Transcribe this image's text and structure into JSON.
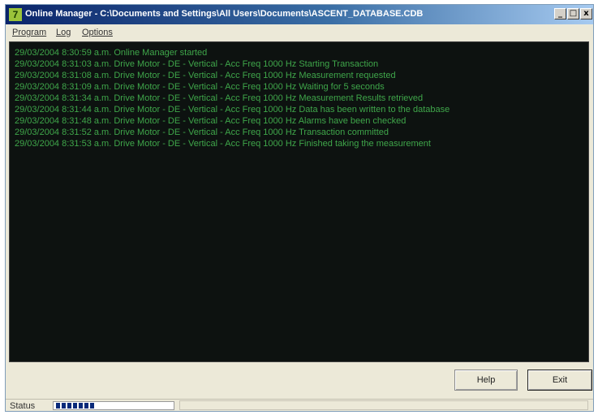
{
  "window": {
    "title": "Online Manager - C:\\Documents and Settings\\All Users\\Documents\\ASCENT_DATABASE.CDB",
    "icon_label": "7",
    "controls": {
      "minimize": "_",
      "maximize": "□",
      "close": "x"
    }
  },
  "menu": [
    "Program",
    "Log",
    "Options"
  ],
  "log": [
    "29/03/2004 8:30:59 a.m.  Online Manager started",
    "29/03/2004 8:31:03 a.m. Drive Motor - DE - Vertical - Acc Freq 1000 Hz  Starting Transaction",
    "29/03/2004 8:31:08 a.m. Drive Motor - DE - Vertical - Acc Freq 1000 Hz  Measurement requested",
    "29/03/2004 8:31:09 a.m. Drive Motor - DE - Vertical - Acc Freq 1000 Hz  Waiting for 5 seconds",
    "29/03/2004 8:31:34 a.m. Drive Motor - DE - Vertical - Acc Freq 1000 Hz  Measurement Results retrieved",
    "29/03/2004 8:31:44 a.m. Drive Motor - DE - Vertical - Acc Freq 1000 Hz  Data has been written to the database",
    "29/03/2004 8:31:48 a.m. Drive Motor - DE - Vertical - Acc Freq 1000 Hz  Alarms have been checked",
    "29/03/2004 8:31:52 a.m. Drive Motor - DE - Vertical - Acc Freq 1000 Hz  Transaction committed",
    "29/03/2004 8:31:53 a.m. Drive Motor - DE - Vertical - Acc Freq 1000 Hz  Finished taking the measurement"
  ],
  "buttons": {
    "help": "Help",
    "exit": "Exit"
  },
  "status": {
    "label": "Status",
    "progress_fraction": 0.33
  },
  "colors": {
    "log_background": "#0d1210",
    "log_text": "#3fa64a",
    "progress_fill": "#0a2a7a"
  },
  "icons": {
    "app": "app-icon",
    "minimize": "minimize-icon",
    "maximize": "maximize-icon",
    "close": "close-icon"
  }
}
